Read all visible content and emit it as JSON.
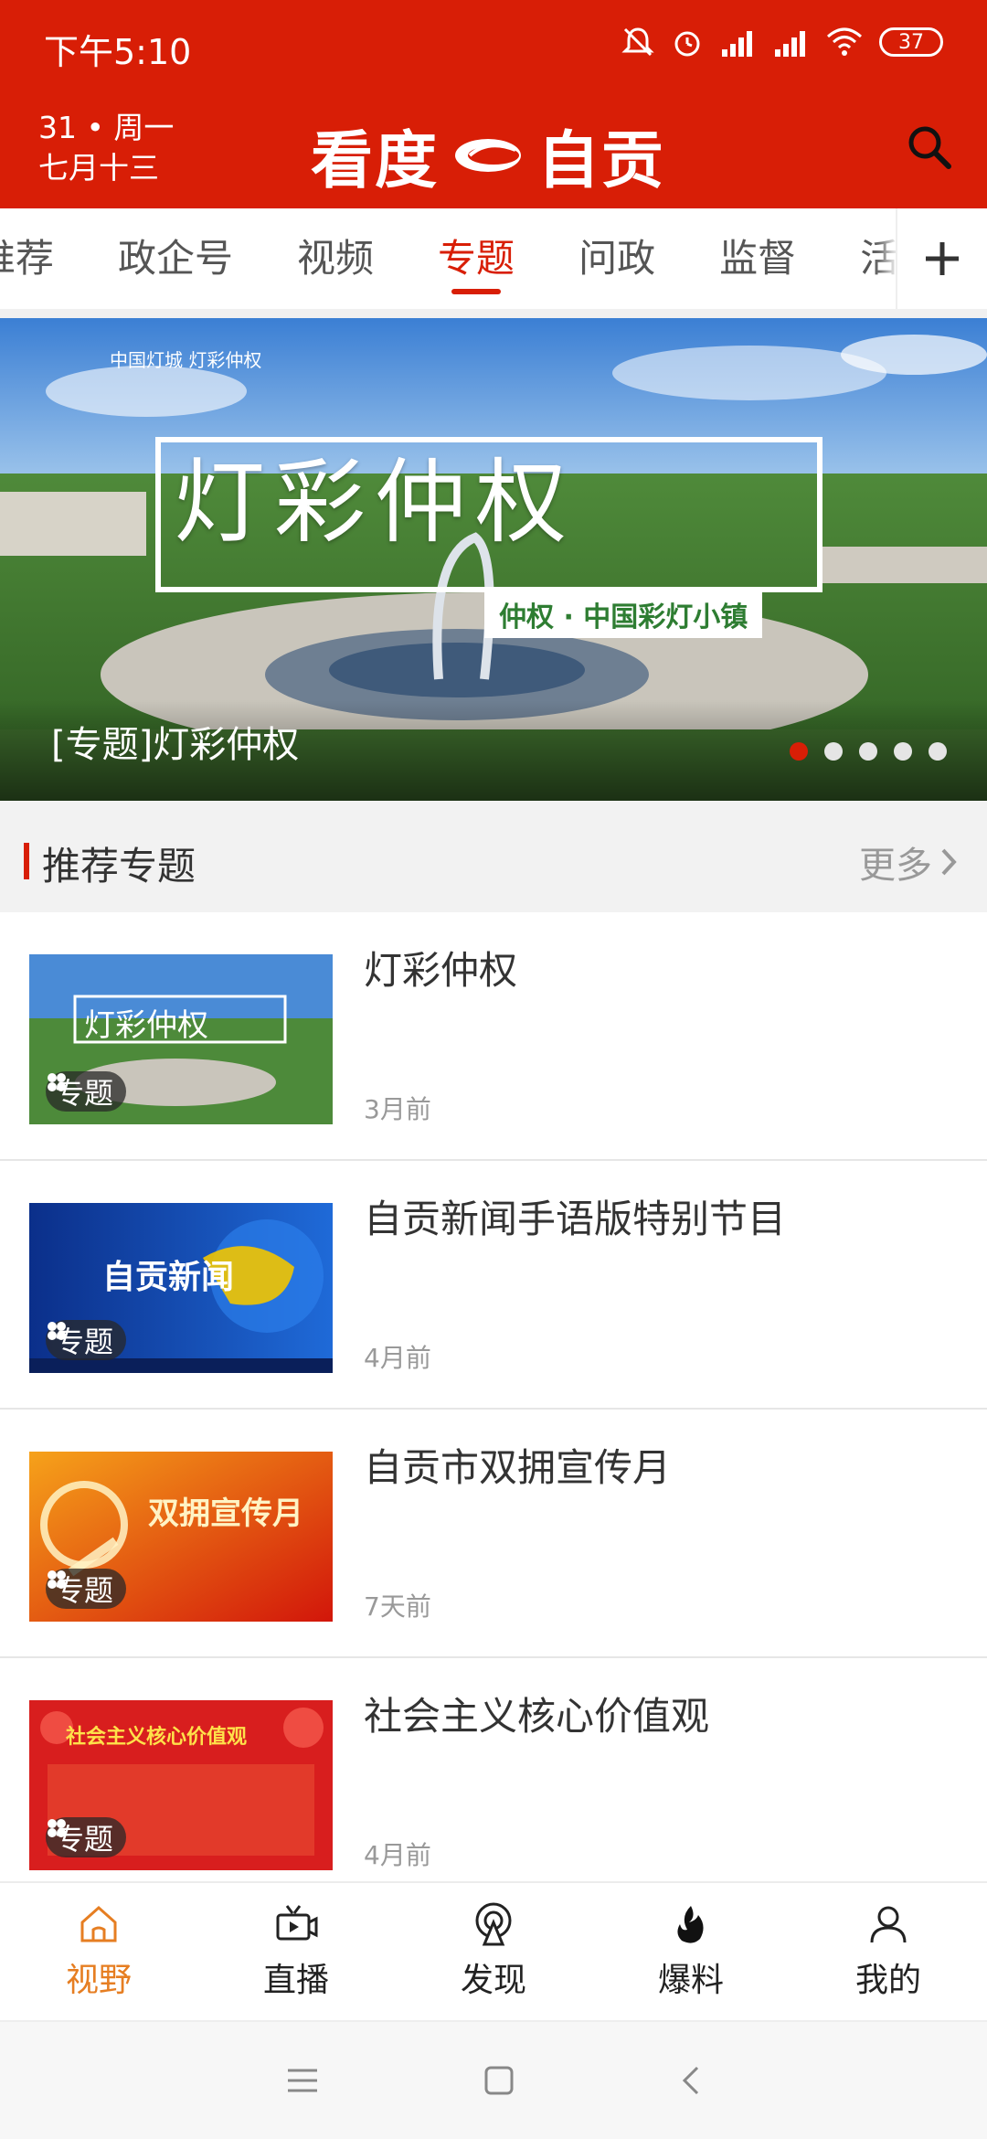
{
  "status": {
    "time": "下午5:10",
    "battery": "37"
  },
  "header": {
    "date_line1": "31 • 周一",
    "date_line2": "七月十三",
    "logo_left": "看度",
    "logo_right": "自贡"
  },
  "tabs": [
    {
      "label": "推荐"
    },
    {
      "label": "政企号"
    },
    {
      "label": "视频"
    },
    {
      "label": "专题",
      "active": true
    },
    {
      "label": "问政"
    },
    {
      "label": "监督"
    },
    {
      "label": "活动"
    }
  ],
  "banner": {
    "top_text": "中国灯城  灯彩仲权",
    "big_text": "灯彩仲权",
    "sub_text": "仲权 · 中国彩灯小镇",
    "caption": "[专题]灯彩仲权",
    "dots_total": 5,
    "dots_active_index": 0
  },
  "section": {
    "title": "推荐专题",
    "more": "更多"
  },
  "items": [
    {
      "title": "灯彩仲权",
      "time": "3月前",
      "badge": "专题",
      "thumb_text": "灯彩仲权"
    },
    {
      "title": "自贡新闻手语版特别节目",
      "time": "4月前",
      "badge": "专题",
      "thumb_text": "自贡新闻"
    },
    {
      "title": "自贡市双拥宣传月",
      "time": "7天前",
      "badge": "专题",
      "thumb_text": "双拥宣传月"
    },
    {
      "title": "社会主义核心价值观",
      "time": "4月前",
      "badge": "专题",
      "thumb_text": "社会主义核心价值观"
    }
  ],
  "bottom_nav": [
    {
      "label": "视野",
      "icon": "home-icon",
      "active": true
    },
    {
      "label": "直播",
      "icon": "tv-icon"
    },
    {
      "label": "发现",
      "icon": "broadcast-icon"
    },
    {
      "label": "爆料",
      "icon": "flame-icon"
    },
    {
      "label": "我的",
      "icon": "user-icon"
    }
  ],
  "colors": {
    "brand": "#d81e06",
    "active_nav": "#e67e22"
  }
}
